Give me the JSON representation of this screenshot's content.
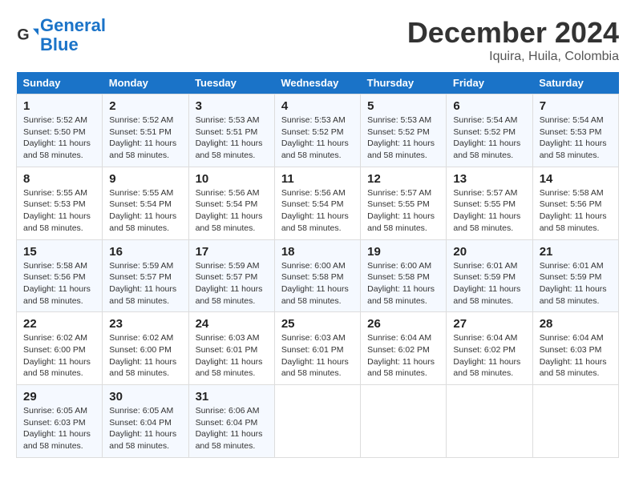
{
  "header": {
    "logo_line1": "General",
    "logo_line2": "Blue",
    "month": "December 2024",
    "location": "Iquira, Huila, Colombia"
  },
  "weekdays": [
    "Sunday",
    "Monday",
    "Tuesday",
    "Wednesday",
    "Thursday",
    "Friday",
    "Saturday"
  ],
  "weeks": [
    [
      {
        "day": "1",
        "info": "Sunrise: 5:52 AM\nSunset: 5:50 PM\nDaylight: 11 hours\nand 58 minutes."
      },
      {
        "day": "2",
        "info": "Sunrise: 5:52 AM\nSunset: 5:51 PM\nDaylight: 11 hours\nand 58 minutes."
      },
      {
        "day": "3",
        "info": "Sunrise: 5:53 AM\nSunset: 5:51 PM\nDaylight: 11 hours\nand 58 minutes."
      },
      {
        "day": "4",
        "info": "Sunrise: 5:53 AM\nSunset: 5:52 PM\nDaylight: 11 hours\nand 58 minutes."
      },
      {
        "day": "5",
        "info": "Sunrise: 5:53 AM\nSunset: 5:52 PM\nDaylight: 11 hours\nand 58 minutes."
      },
      {
        "day": "6",
        "info": "Sunrise: 5:54 AM\nSunset: 5:52 PM\nDaylight: 11 hours\nand 58 minutes."
      },
      {
        "day": "7",
        "info": "Sunrise: 5:54 AM\nSunset: 5:53 PM\nDaylight: 11 hours\nand 58 minutes."
      }
    ],
    [
      {
        "day": "8",
        "info": "Sunrise: 5:55 AM\nSunset: 5:53 PM\nDaylight: 11 hours\nand 58 minutes."
      },
      {
        "day": "9",
        "info": "Sunrise: 5:55 AM\nSunset: 5:54 PM\nDaylight: 11 hours\nand 58 minutes."
      },
      {
        "day": "10",
        "info": "Sunrise: 5:56 AM\nSunset: 5:54 PM\nDaylight: 11 hours\nand 58 minutes."
      },
      {
        "day": "11",
        "info": "Sunrise: 5:56 AM\nSunset: 5:54 PM\nDaylight: 11 hours\nand 58 minutes."
      },
      {
        "day": "12",
        "info": "Sunrise: 5:57 AM\nSunset: 5:55 PM\nDaylight: 11 hours\nand 58 minutes."
      },
      {
        "day": "13",
        "info": "Sunrise: 5:57 AM\nSunset: 5:55 PM\nDaylight: 11 hours\nand 58 minutes."
      },
      {
        "day": "14",
        "info": "Sunrise: 5:58 AM\nSunset: 5:56 PM\nDaylight: 11 hours\nand 58 minutes."
      }
    ],
    [
      {
        "day": "15",
        "info": "Sunrise: 5:58 AM\nSunset: 5:56 PM\nDaylight: 11 hours\nand 58 minutes."
      },
      {
        "day": "16",
        "info": "Sunrise: 5:59 AM\nSunset: 5:57 PM\nDaylight: 11 hours\nand 58 minutes."
      },
      {
        "day": "17",
        "info": "Sunrise: 5:59 AM\nSunset: 5:57 PM\nDaylight: 11 hours\nand 58 minutes."
      },
      {
        "day": "18",
        "info": "Sunrise: 6:00 AM\nSunset: 5:58 PM\nDaylight: 11 hours\nand 58 minutes."
      },
      {
        "day": "19",
        "info": "Sunrise: 6:00 AM\nSunset: 5:58 PM\nDaylight: 11 hours\nand 58 minutes."
      },
      {
        "day": "20",
        "info": "Sunrise: 6:01 AM\nSunset: 5:59 PM\nDaylight: 11 hours\nand 58 minutes."
      },
      {
        "day": "21",
        "info": "Sunrise: 6:01 AM\nSunset: 5:59 PM\nDaylight: 11 hours\nand 58 minutes."
      }
    ],
    [
      {
        "day": "22",
        "info": "Sunrise: 6:02 AM\nSunset: 6:00 PM\nDaylight: 11 hours\nand 58 minutes."
      },
      {
        "day": "23",
        "info": "Sunrise: 6:02 AM\nSunset: 6:00 PM\nDaylight: 11 hours\nand 58 minutes."
      },
      {
        "day": "24",
        "info": "Sunrise: 6:03 AM\nSunset: 6:01 PM\nDaylight: 11 hours\nand 58 minutes."
      },
      {
        "day": "25",
        "info": "Sunrise: 6:03 AM\nSunset: 6:01 PM\nDaylight: 11 hours\nand 58 minutes."
      },
      {
        "day": "26",
        "info": "Sunrise: 6:04 AM\nSunset: 6:02 PM\nDaylight: 11 hours\nand 58 minutes."
      },
      {
        "day": "27",
        "info": "Sunrise: 6:04 AM\nSunset: 6:02 PM\nDaylight: 11 hours\nand 58 minutes."
      },
      {
        "day": "28",
        "info": "Sunrise: 6:04 AM\nSunset: 6:03 PM\nDaylight: 11 hours\nand 58 minutes."
      }
    ],
    [
      {
        "day": "29",
        "info": "Sunrise: 6:05 AM\nSunset: 6:03 PM\nDaylight: 11 hours\nand 58 minutes."
      },
      {
        "day": "30",
        "info": "Sunrise: 6:05 AM\nSunset: 6:04 PM\nDaylight: 11 hours\nand 58 minutes."
      },
      {
        "day": "31",
        "info": "Sunrise: 6:06 AM\nSunset: 6:04 PM\nDaylight: 11 hours\nand 58 minutes."
      },
      {
        "day": "",
        "info": ""
      },
      {
        "day": "",
        "info": ""
      },
      {
        "day": "",
        "info": ""
      },
      {
        "day": "",
        "info": ""
      }
    ]
  ]
}
